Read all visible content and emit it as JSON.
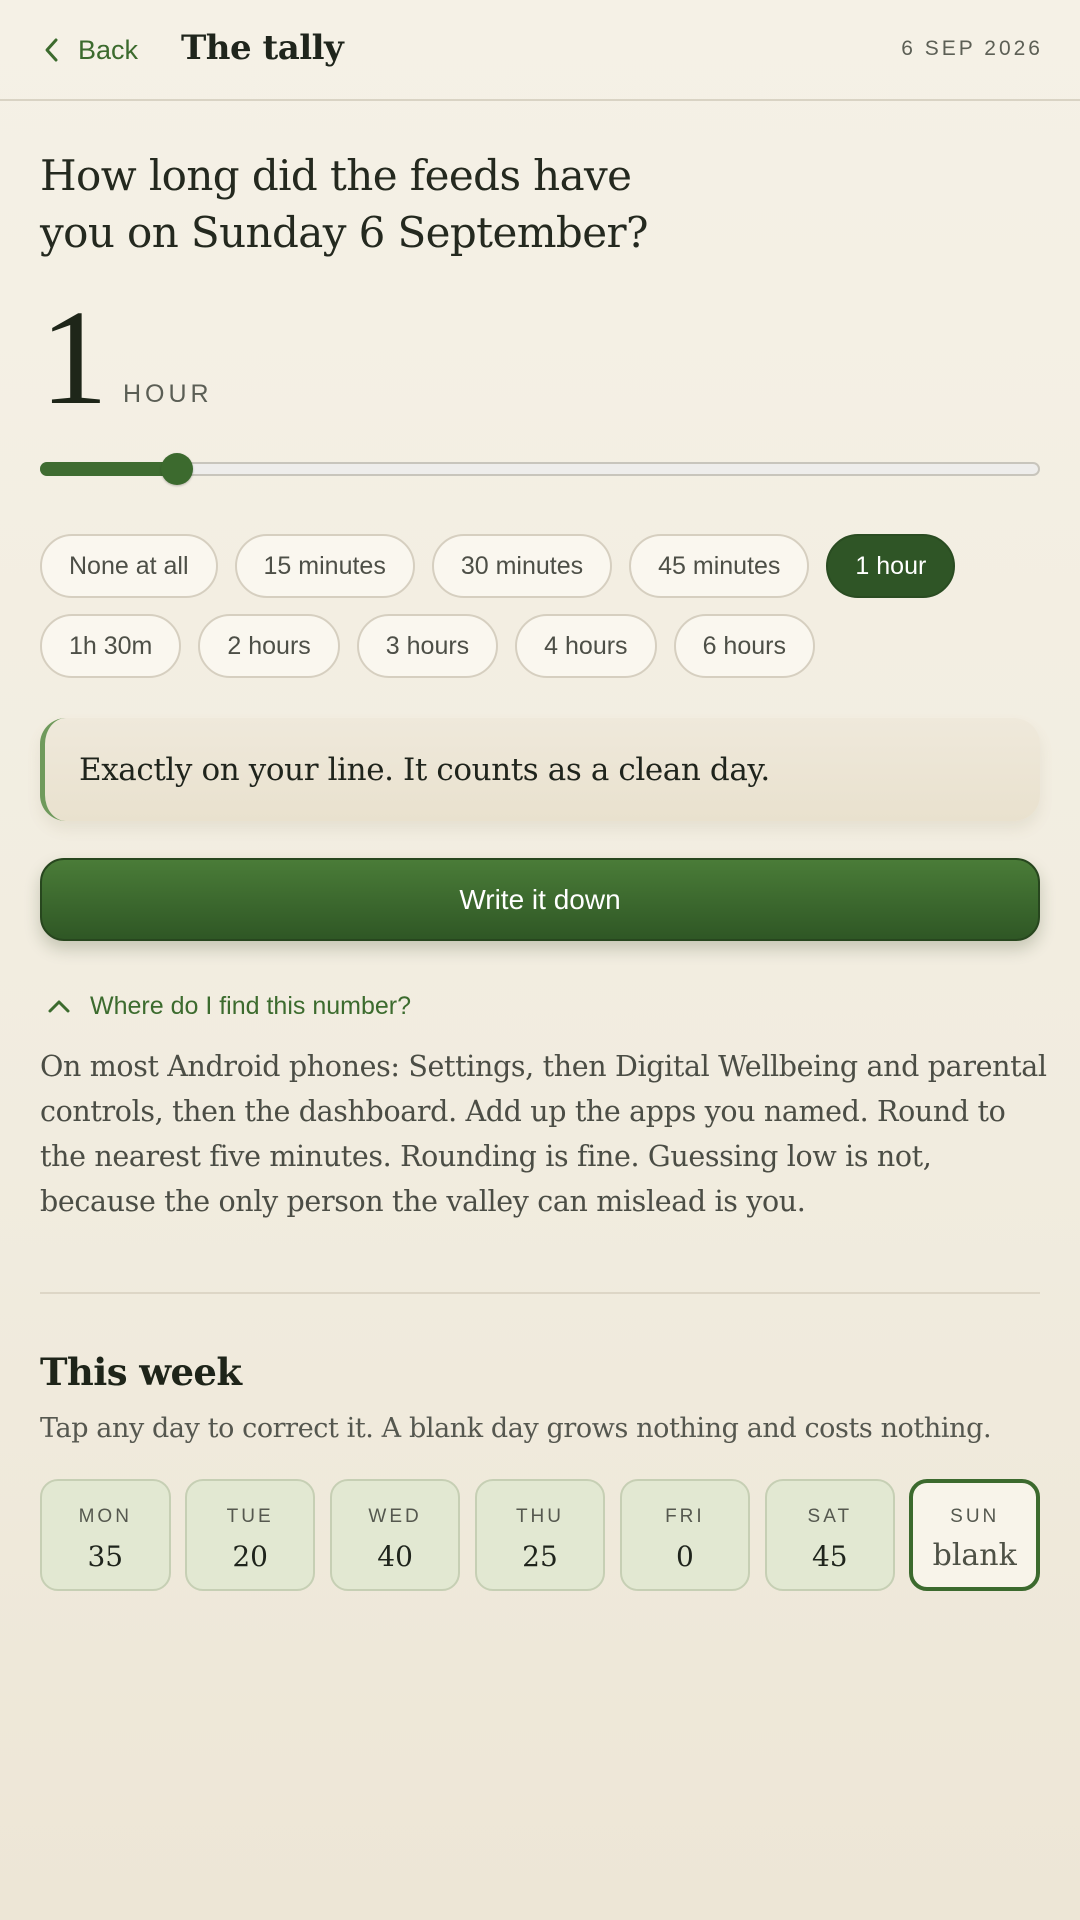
{
  "header": {
    "back_label": "Back",
    "title": "The tally",
    "date": "6 SEP 2026"
  },
  "question": "How long did the feeds have you on Sunday 6 September?",
  "value": {
    "number": "1",
    "unit": "HOUR",
    "slider_fraction": 0.137
  },
  "chips": [
    {
      "label": "None at all",
      "selected": false
    },
    {
      "label": "15 minutes",
      "selected": false
    },
    {
      "label": "30 minutes",
      "selected": false
    },
    {
      "label": "45 minutes",
      "selected": false
    },
    {
      "label": "1 hour",
      "selected": true
    },
    {
      "label": "1h 30m",
      "selected": false
    },
    {
      "label": "2 hours",
      "selected": false
    },
    {
      "label": "3 hours",
      "selected": false
    },
    {
      "label": "4 hours",
      "selected": false
    },
    {
      "label": "6 hours",
      "selected": false
    }
  ],
  "callout": "Exactly on your line. It counts as a clean day.",
  "primary_button": "Write it down",
  "help": {
    "toggle_label": "Where do I find this number?",
    "expanded": true,
    "text": "On most Android phones: Settings, then Digital Wellbeing and parental controls, then the dashboard. Add up the apps you named. Round to the nearest five minutes. Rounding is fine. Guessing low is not, because the only person the valley can mislead is you."
  },
  "week": {
    "title": "This week",
    "subtitle": "Tap any day to correct it. A blank day grows nothing and costs nothing.",
    "days": [
      {
        "label": "MON",
        "value": "35"
      },
      {
        "label": "TUE",
        "value": "20"
      },
      {
        "label": "WED",
        "value": "40"
      },
      {
        "label": "THU",
        "value": "25"
      },
      {
        "label": "FRI",
        "value": "0"
      },
      {
        "label": "SAT",
        "value": "45"
      },
      {
        "label": "SUN",
        "value": "blank",
        "current": true
      }
    ]
  },
  "colors": {
    "accent": "#3c6a2e",
    "background": "#f3eee2",
    "day_fill": "#e2e8d2"
  }
}
